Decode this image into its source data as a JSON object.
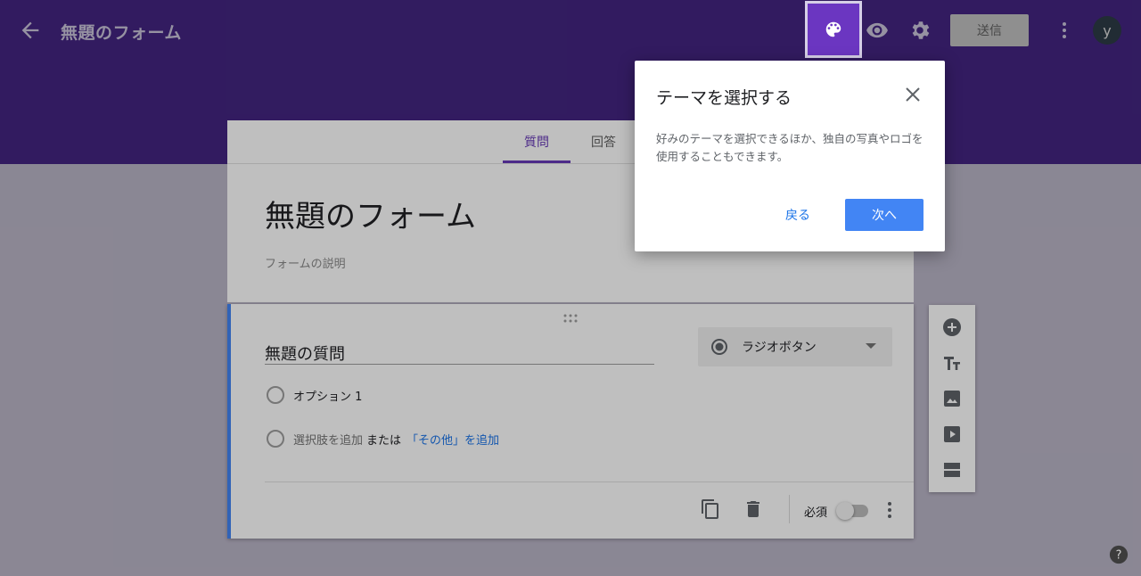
{
  "header": {
    "title": "無題のフォーム",
    "send_label": "送信",
    "avatar_initial": "y",
    "icons": [
      "back-arrow-icon",
      "palette-icon",
      "eye-icon",
      "gear-icon",
      "more-vert-icon"
    ]
  },
  "tabs": [
    {
      "label": "質問",
      "active": true
    },
    {
      "label": "回答",
      "active": false
    }
  ],
  "form": {
    "title": "無題のフォーム",
    "description_placeholder": "フォームの説明"
  },
  "question": {
    "title": "無題の質問",
    "type_label": "ラジオボタン",
    "option1": "オプション 1",
    "add_option": "選択肢を追加",
    "or_text": "または",
    "add_other": "「その他」を追加",
    "required_label": "必須",
    "required": false
  },
  "dialog": {
    "title": "テーマを選択する",
    "body": "好みのテーマを選択できるほか、独自の写真やロゴを使用することもできます。",
    "back_label": "戻る",
    "next_label": "次へ"
  },
  "colors": {
    "header_purple": "#432580",
    "palette_active": "#6b36c1",
    "accent_blue": "#4285f4",
    "tab_active": "#673ab7"
  }
}
